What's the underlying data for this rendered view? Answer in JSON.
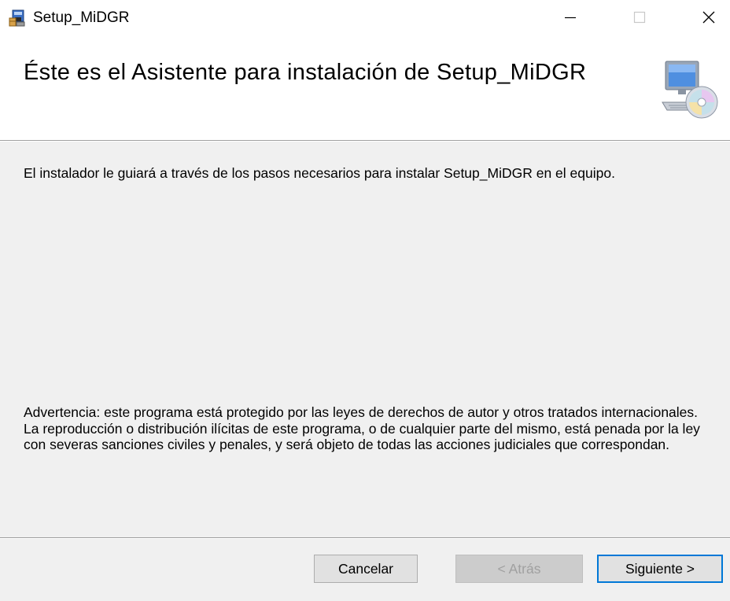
{
  "window": {
    "title": "Setup_MiDGR",
    "app_icon": "installer-icon",
    "controls": {
      "minimize_icon": "minimize-icon",
      "maximize_icon": "maximize-icon",
      "close_icon": "close-icon"
    }
  },
  "header": {
    "title": "Éste es el Asistente para instalación de Setup_MiDGR",
    "icon": "computer-disc-icon"
  },
  "body": {
    "intro": "El instalador le guiará a través de los pasos necesarios para instalar Setup_MiDGR en el equipo.",
    "warning": "Advertencia: este programa está protegido por las leyes de derechos de autor y otros tratados internacionales. La reproducción o distribución ilícitas de este programa, o de cualquier parte del mismo, está penada por la ley con severas sanciones civiles y penales, y será objeto de todas las acciones judiciales que correspondan."
  },
  "buttons": {
    "cancel": "Cancelar",
    "back": "< Atrás",
    "next": "Siguiente >"
  },
  "colors": {
    "window_bg": "#f0f0f0",
    "header_bg": "#ffffff",
    "default_button_border": "#0078d7",
    "disabled_text": "#a0a0a0"
  }
}
